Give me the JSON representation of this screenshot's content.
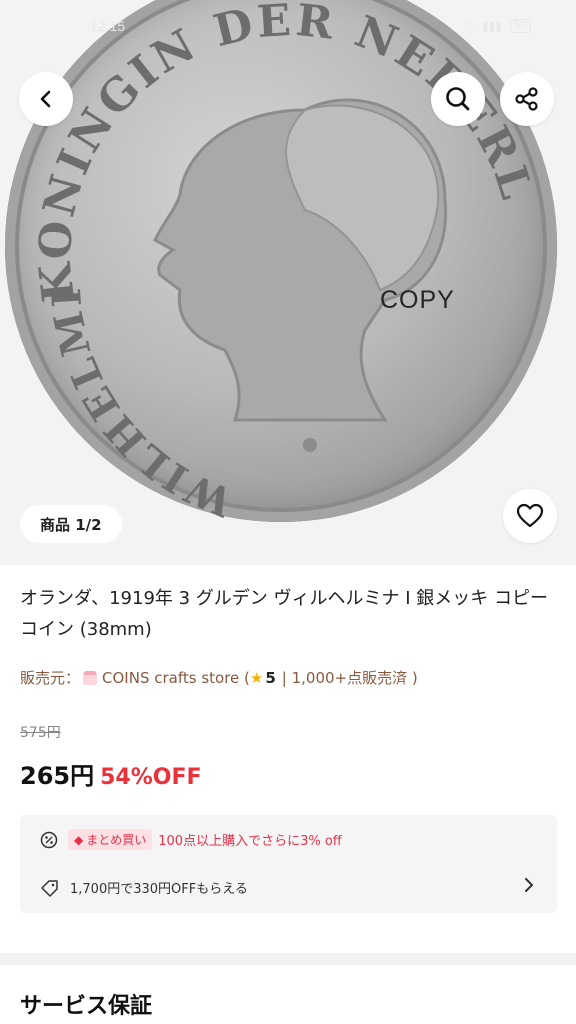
{
  "status_bar": {
    "time": "12:15",
    "battery": "50"
  },
  "hero": {
    "coin_text_top": "KONINGIN DER NEDERLANDEN",
    "coin_text_left": "WILHELMINA",
    "copy_mark": "COPY",
    "image_counter": "商品 1/2"
  },
  "nav": {
    "back_icon": "chevron-left-icon",
    "search_icon": "search-icon",
    "share_icon": "share-icon",
    "wishlist_icon": "heart-icon"
  },
  "product": {
    "title": "オランダ、1919年 3 グルデン ヴィルヘルミナ I 銀メッキ コピー コイン (38mm)",
    "seller_label": "販売元：",
    "store_name": "COINS crafts store (",
    "rating": "5",
    "sold_text": "| 1,000+点販売済 )",
    "original_price": "575円",
    "price": "265円",
    "discount": "54%OFF"
  },
  "promo": {
    "bulk_tag": "まとめ買い",
    "bulk_text": "100点以上購入でさらに3% off",
    "coupon_text": "1,700円で330円OFFもらえる"
  },
  "section": {
    "title": "サービス保証"
  },
  "colors": {
    "accent_red": "#e8323c",
    "seller_brown": "#8a5a40",
    "promo_bg": "#f5f5f5"
  }
}
